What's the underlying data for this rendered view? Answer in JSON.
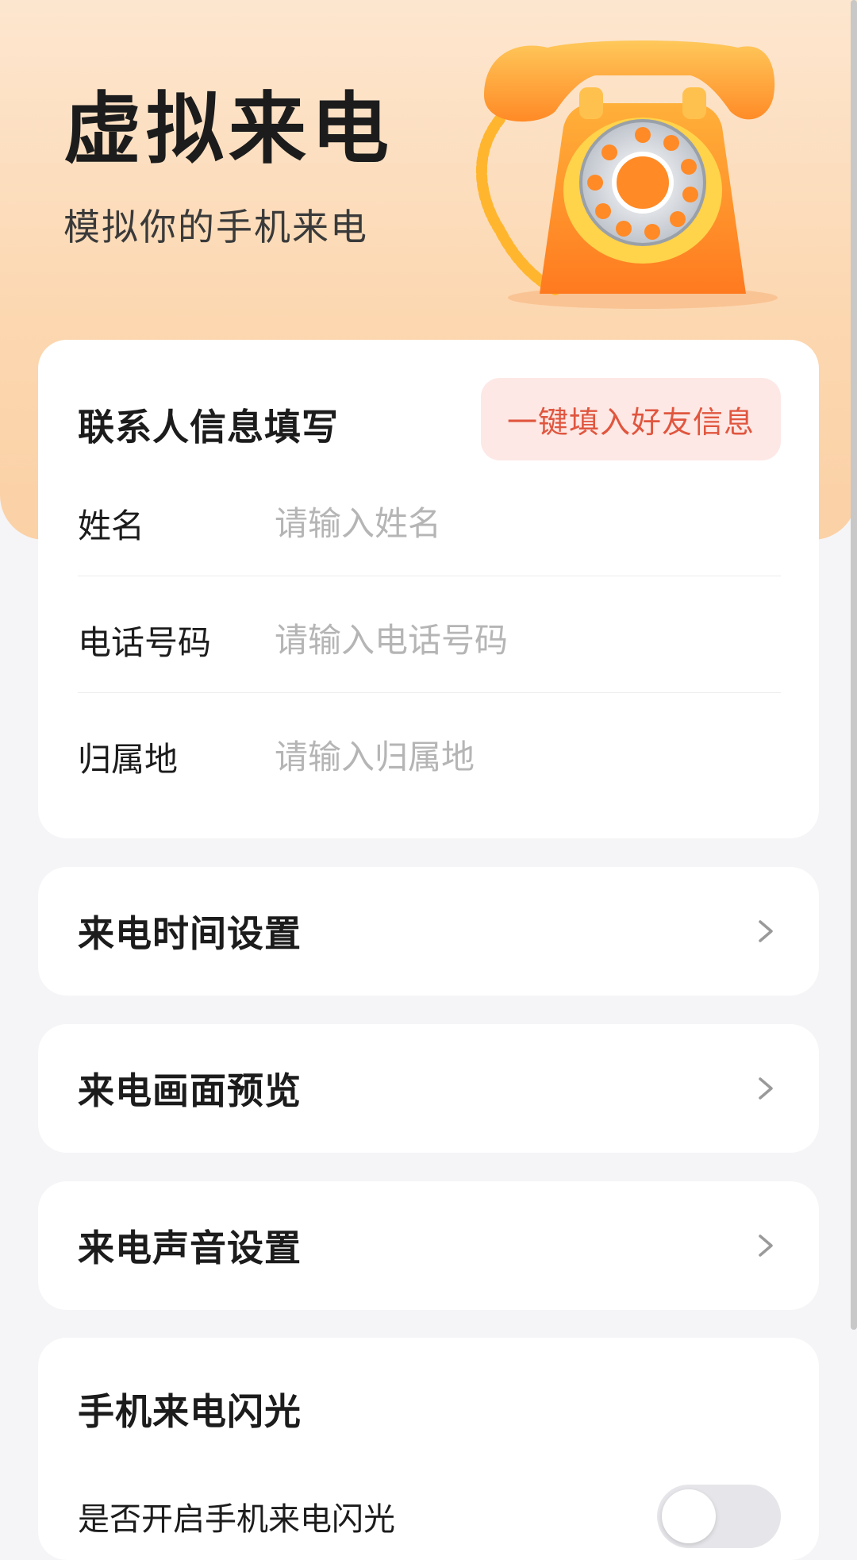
{
  "header": {
    "title": "虚拟来电",
    "subtitle": "模拟你的手机来电"
  },
  "contact_card": {
    "title": "联系人信息填写",
    "fill_button_label": "一键填入好友信息",
    "fields": [
      {
        "label": "姓名",
        "value": "",
        "placeholder": "请输入姓名"
      },
      {
        "label": "电话号码",
        "value": "",
        "placeholder": "请输入电话号码"
      },
      {
        "label": "归属地",
        "value": "",
        "placeholder": "请输入归属地"
      }
    ]
  },
  "menu": [
    {
      "label": "来电时间设置",
      "icon": "chevron-right-icon"
    },
    {
      "label": "来电画面预览",
      "icon": "chevron-right-icon"
    },
    {
      "label": "来电声音设置",
      "icon": "chevron-right-icon"
    }
  ],
  "flash": {
    "title": "手机来电闪光",
    "toggle_label": "是否开启手机来电闪光",
    "enabled": false
  },
  "colors": {
    "hero_gradient_top": "#fde6cf",
    "hero_gradient_bottom": "#fbd1a6",
    "accent_text": "#e0563f",
    "accent_bg": "#fde8e5",
    "page_bg": "#f5f5f7"
  }
}
